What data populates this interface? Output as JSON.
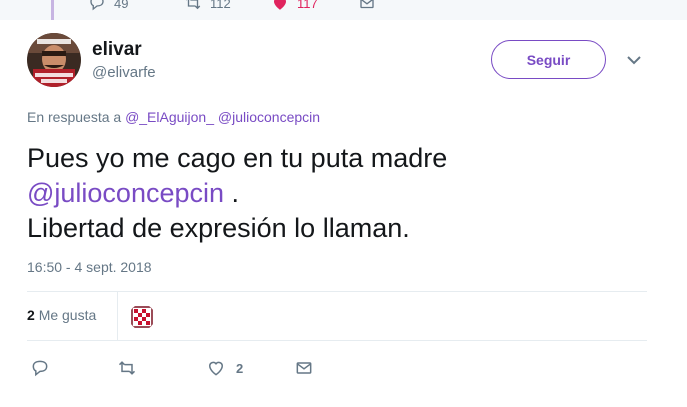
{
  "previous_tweet": {
    "reply_count": "49",
    "retweet_count": "112",
    "like_count": "117"
  },
  "author": {
    "display_name": "elivar",
    "handle": "@elivarfe",
    "avatar_icon": "meme-avatar-icon"
  },
  "follow_button": {
    "label": "Seguir"
  },
  "reply_to": {
    "prefix": "En respuesta a",
    "mentions": [
      "@_ElAguijon_",
      "@julioconcepcin"
    ]
  },
  "tweet": {
    "line1": "Pues yo me cago en tu puta madre",
    "mention": "@julioconcepcin",
    "after_mention": " .",
    "line3": "Libertad de expresión lo llaman."
  },
  "timestamp": "16:50 - 4 sept. 2018",
  "stats": {
    "likes_number": "2",
    "likes_label": "Me gusta"
  },
  "actions": {
    "reply_count": "",
    "retweet_count": "",
    "like_count": "2",
    "dm_count": ""
  },
  "colors": {
    "accent": "#794bc4",
    "like": "#e0245e",
    "secondary_text": "#657786"
  }
}
